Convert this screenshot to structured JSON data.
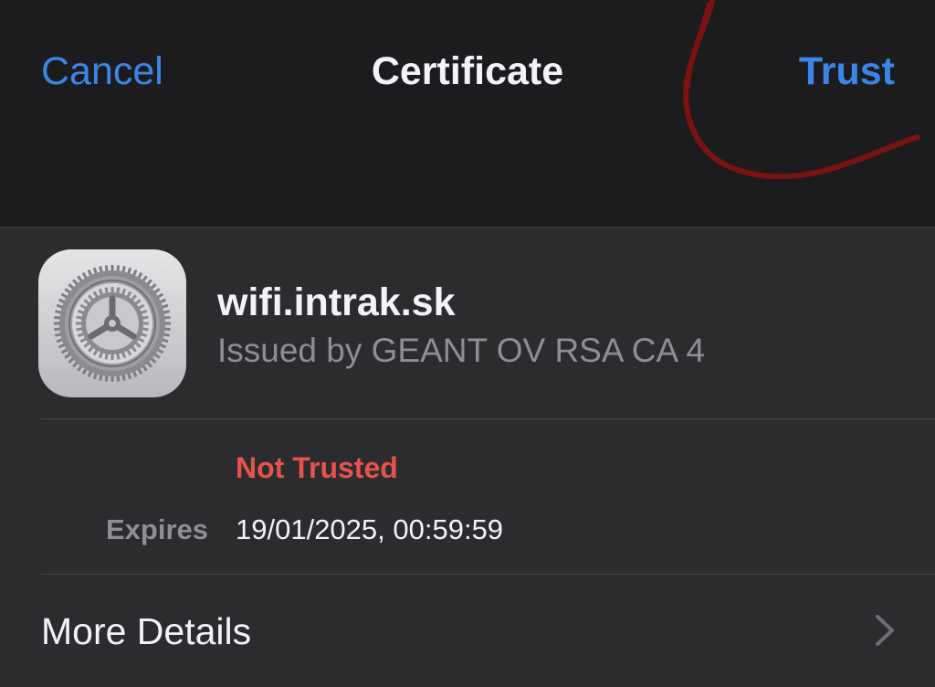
{
  "navbar": {
    "cancel_label": "Cancel",
    "title": "Certificate",
    "trust_label": "Trust"
  },
  "certificate": {
    "icon": "settings-gear-icon",
    "name": "wifi.intrak.sk",
    "issuer": "Issued by GEANT OV RSA CA 4",
    "status": "Not Trusted",
    "expires_label": "Expires",
    "expires_value": "19/01/2025, 00:59:59"
  },
  "more_details": {
    "label": "More Details",
    "icon": "chevron-right-icon"
  },
  "colors": {
    "background": "#1c1c1e",
    "card": "#2c2c2e",
    "accent": "#3a86e8",
    "warning": "#e5534b",
    "annotation": "#7a1212"
  }
}
